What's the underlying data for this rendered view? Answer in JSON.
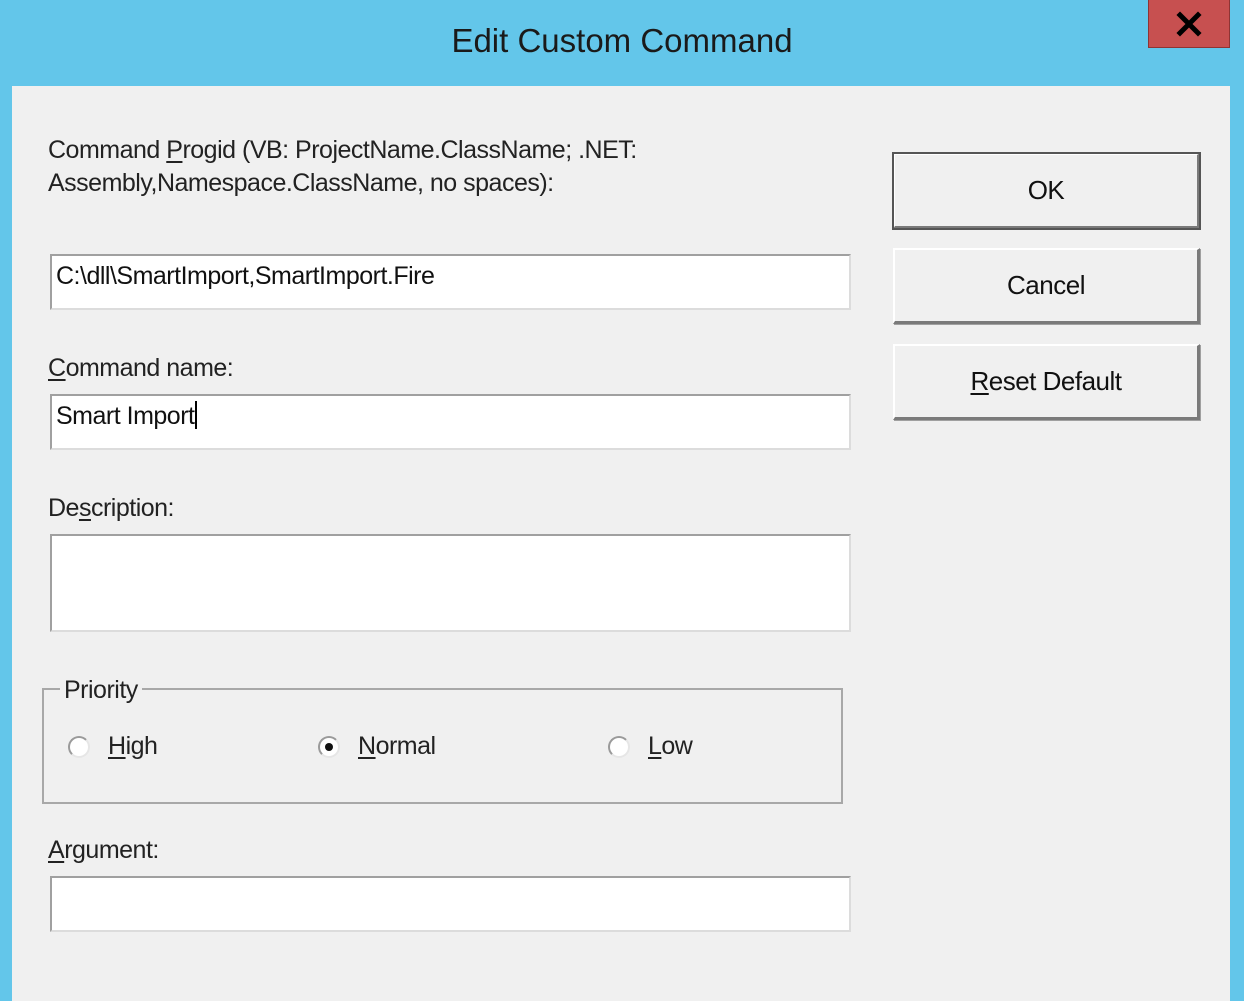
{
  "window": {
    "title": "Edit Custom Command",
    "close_glyph": "X"
  },
  "progid": {
    "label_line1_pre": "Command ",
    "label_line1_accel": "P",
    "label_line1_post": "rogid (VB: ProjectName.ClassName; .NET:",
    "label_line2": "Assembly,Namespace.ClassName, no spaces):",
    "value": "C:\\dll\\SmartImport,SmartImport.Fire"
  },
  "command_name": {
    "label_accel": "C",
    "label_rest": "ommand name:",
    "value": "Smart Import"
  },
  "description": {
    "label_pre": "De",
    "label_accel": "s",
    "label_post": "cription:",
    "value": ""
  },
  "priority": {
    "legend": "Priority",
    "options": [
      {
        "accel": "H",
        "rest": "igh",
        "selected": false
      },
      {
        "accel": "N",
        "rest": "ormal",
        "selected": true
      },
      {
        "accel": "L",
        "rest": "ow",
        "selected": false
      }
    ]
  },
  "argument": {
    "label_accel": "A",
    "label_rest": "rgument:",
    "value": ""
  },
  "buttons": {
    "ok": "OK",
    "cancel": "Cancel",
    "reset_accel": "R",
    "reset_rest": "eset Default"
  },
  "colors": {
    "title_bar": "#63c6ea",
    "close_button": "#c75050",
    "client_bg": "#f0f0f0"
  }
}
